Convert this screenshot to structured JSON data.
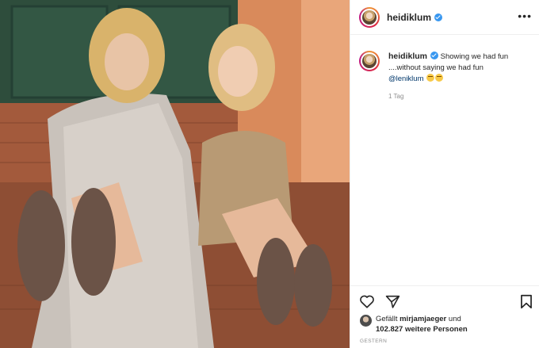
{
  "post": {
    "username": "heidiklum",
    "verified": true,
    "more_label": "•••",
    "caption": {
      "username": "heidiklum",
      "text": "Showing we had fun ....without saying we had fun",
      "mention": "@leniklum",
      "emojis": [
        "laughing-face-emoji",
        "laughing-face-emoji"
      ]
    },
    "time_ago": "1 Tag",
    "likes": {
      "prefix": "Gefällt",
      "user": "mirjamjaeger",
      "conjunction": "und",
      "count_text": "102.827 weitere Personen"
    },
    "date": "GESTERN"
  },
  "icons": {
    "like": "heart-icon",
    "share": "share-icon",
    "save": "bookmark-icon",
    "verified": "verified-badge-icon"
  },
  "colors": {
    "verified": "#3897f0",
    "mention": "#00376b",
    "muted": "#8e8e8e",
    "text": "#262626"
  }
}
